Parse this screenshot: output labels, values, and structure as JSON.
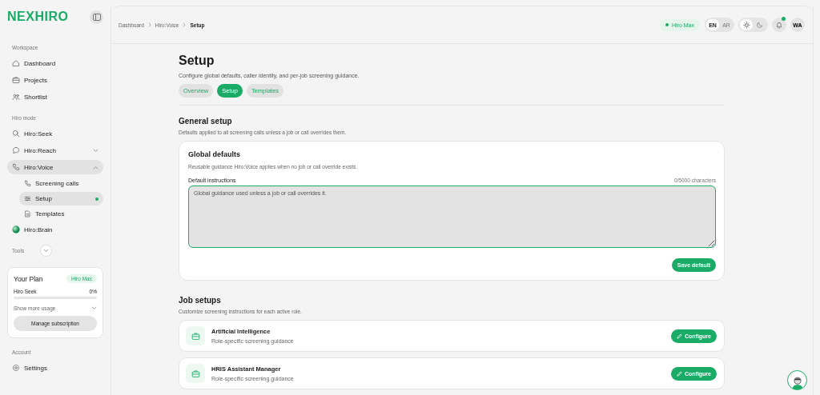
{
  "logo": "NEXHIRO",
  "sidebar": {
    "sections": [
      {
        "heading": "Workspace",
        "items": [
          {
            "label": "Dashboard",
            "selected": false
          },
          {
            "label": "Projects",
            "selected": false
          },
          {
            "label": "Shortlist",
            "selected": false
          }
        ]
      },
      {
        "heading": "Hiro mode",
        "items": [
          {
            "label": "Hiro:Seek",
            "selected": false
          },
          {
            "label": "Hiro:Reach",
            "selected": false,
            "expanded": false
          },
          {
            "label": "Hiro:Voice",
            "selected": true,
            "expanded": true,
            "children": [
              {
                "label": "Screening calls",
                "selected": false
              },
              {
                "label": "Setup",
                "selected": true
              },
              {
                "label": "Templates",
                "selected": false
              }
            ]
          },
          {
            "label": "Hiro:Brain",
            "selected": false
          }
        ]
      }
    ],
    "tools": {
      "heading": "Tools"
    },
    "plan": {
      "title": "Your Plan",
      "badge": "Hiro Max",
      "usage": [
        {
          "label": "Hiro Seek",
          "reading": "0%",
          "level": 0
        }
      ],
      "more": "Show more usage",
      "button": "Manage subscription"
    },
    "account": {
      "heading": "Account",
      "items": [
        {
          "label": "Settings",
          "selected": false
        }
      ]
    }
  },
  "topbar": {
    "breadcrumb": [
      "Dashboard",
      "Hiro:Voice",
      "Setup"
    ],
    "plan_badge": "Hiro Max",
    "languages": [
      {
        "label": "EN",
        "selected": true
      },
      {
        "label": "AR",
        "selected": false
      }
    ],
    "theme": [
      {
        "kind": "light",
        "selected": true
      },
      {
        "kind": "dark",
        "selected": false
      }
    ],
    "notifications": {
      "unread": true
    },
    "avatar": "WA"
  },
  "page": {
    "title": "Setup",
    "subtitle": "Configure global defaults, caller identity, and per-job screening guidance.",
    "tabs": [
      {
        "label": "Overview",
        "selected": false
      },
      {
        "label": "Setup",
        "selected": true
      },
      {
        "label": "Templates",
        "selected": false
      }
    ],
    "general": {
      "title": "General setup",
      "subtitle": "Defaults applied to all screening calls unless a job or call overrides them.",
      "card": {
        "title": "Global defaults",
        "subtitle": "Reusable guidance Hiro:Voice applies when no job or call override exists.",
        "field_label": "Default instructions",
        "counter": "0/5000 characters",
        "placeholder": "Global guidance used unless a job or call overrides it.",
        "button": "Save default"
      }
    },
    "jobs": {
      "title": "Job setups",
      "subtitle": "Customize screening instructions for each active role.",
      "rows": [
        {
          "name": "Artificial Intelligence",
          "detail": "Role-specific screening guidance",
          "button": "Configure"
        },
        {
          "name": "HRIS Assistant Manager",
          "detail": "Role-specific screening guidance",
          "button": "Configure"
        }
      ]
    }
  }
}
